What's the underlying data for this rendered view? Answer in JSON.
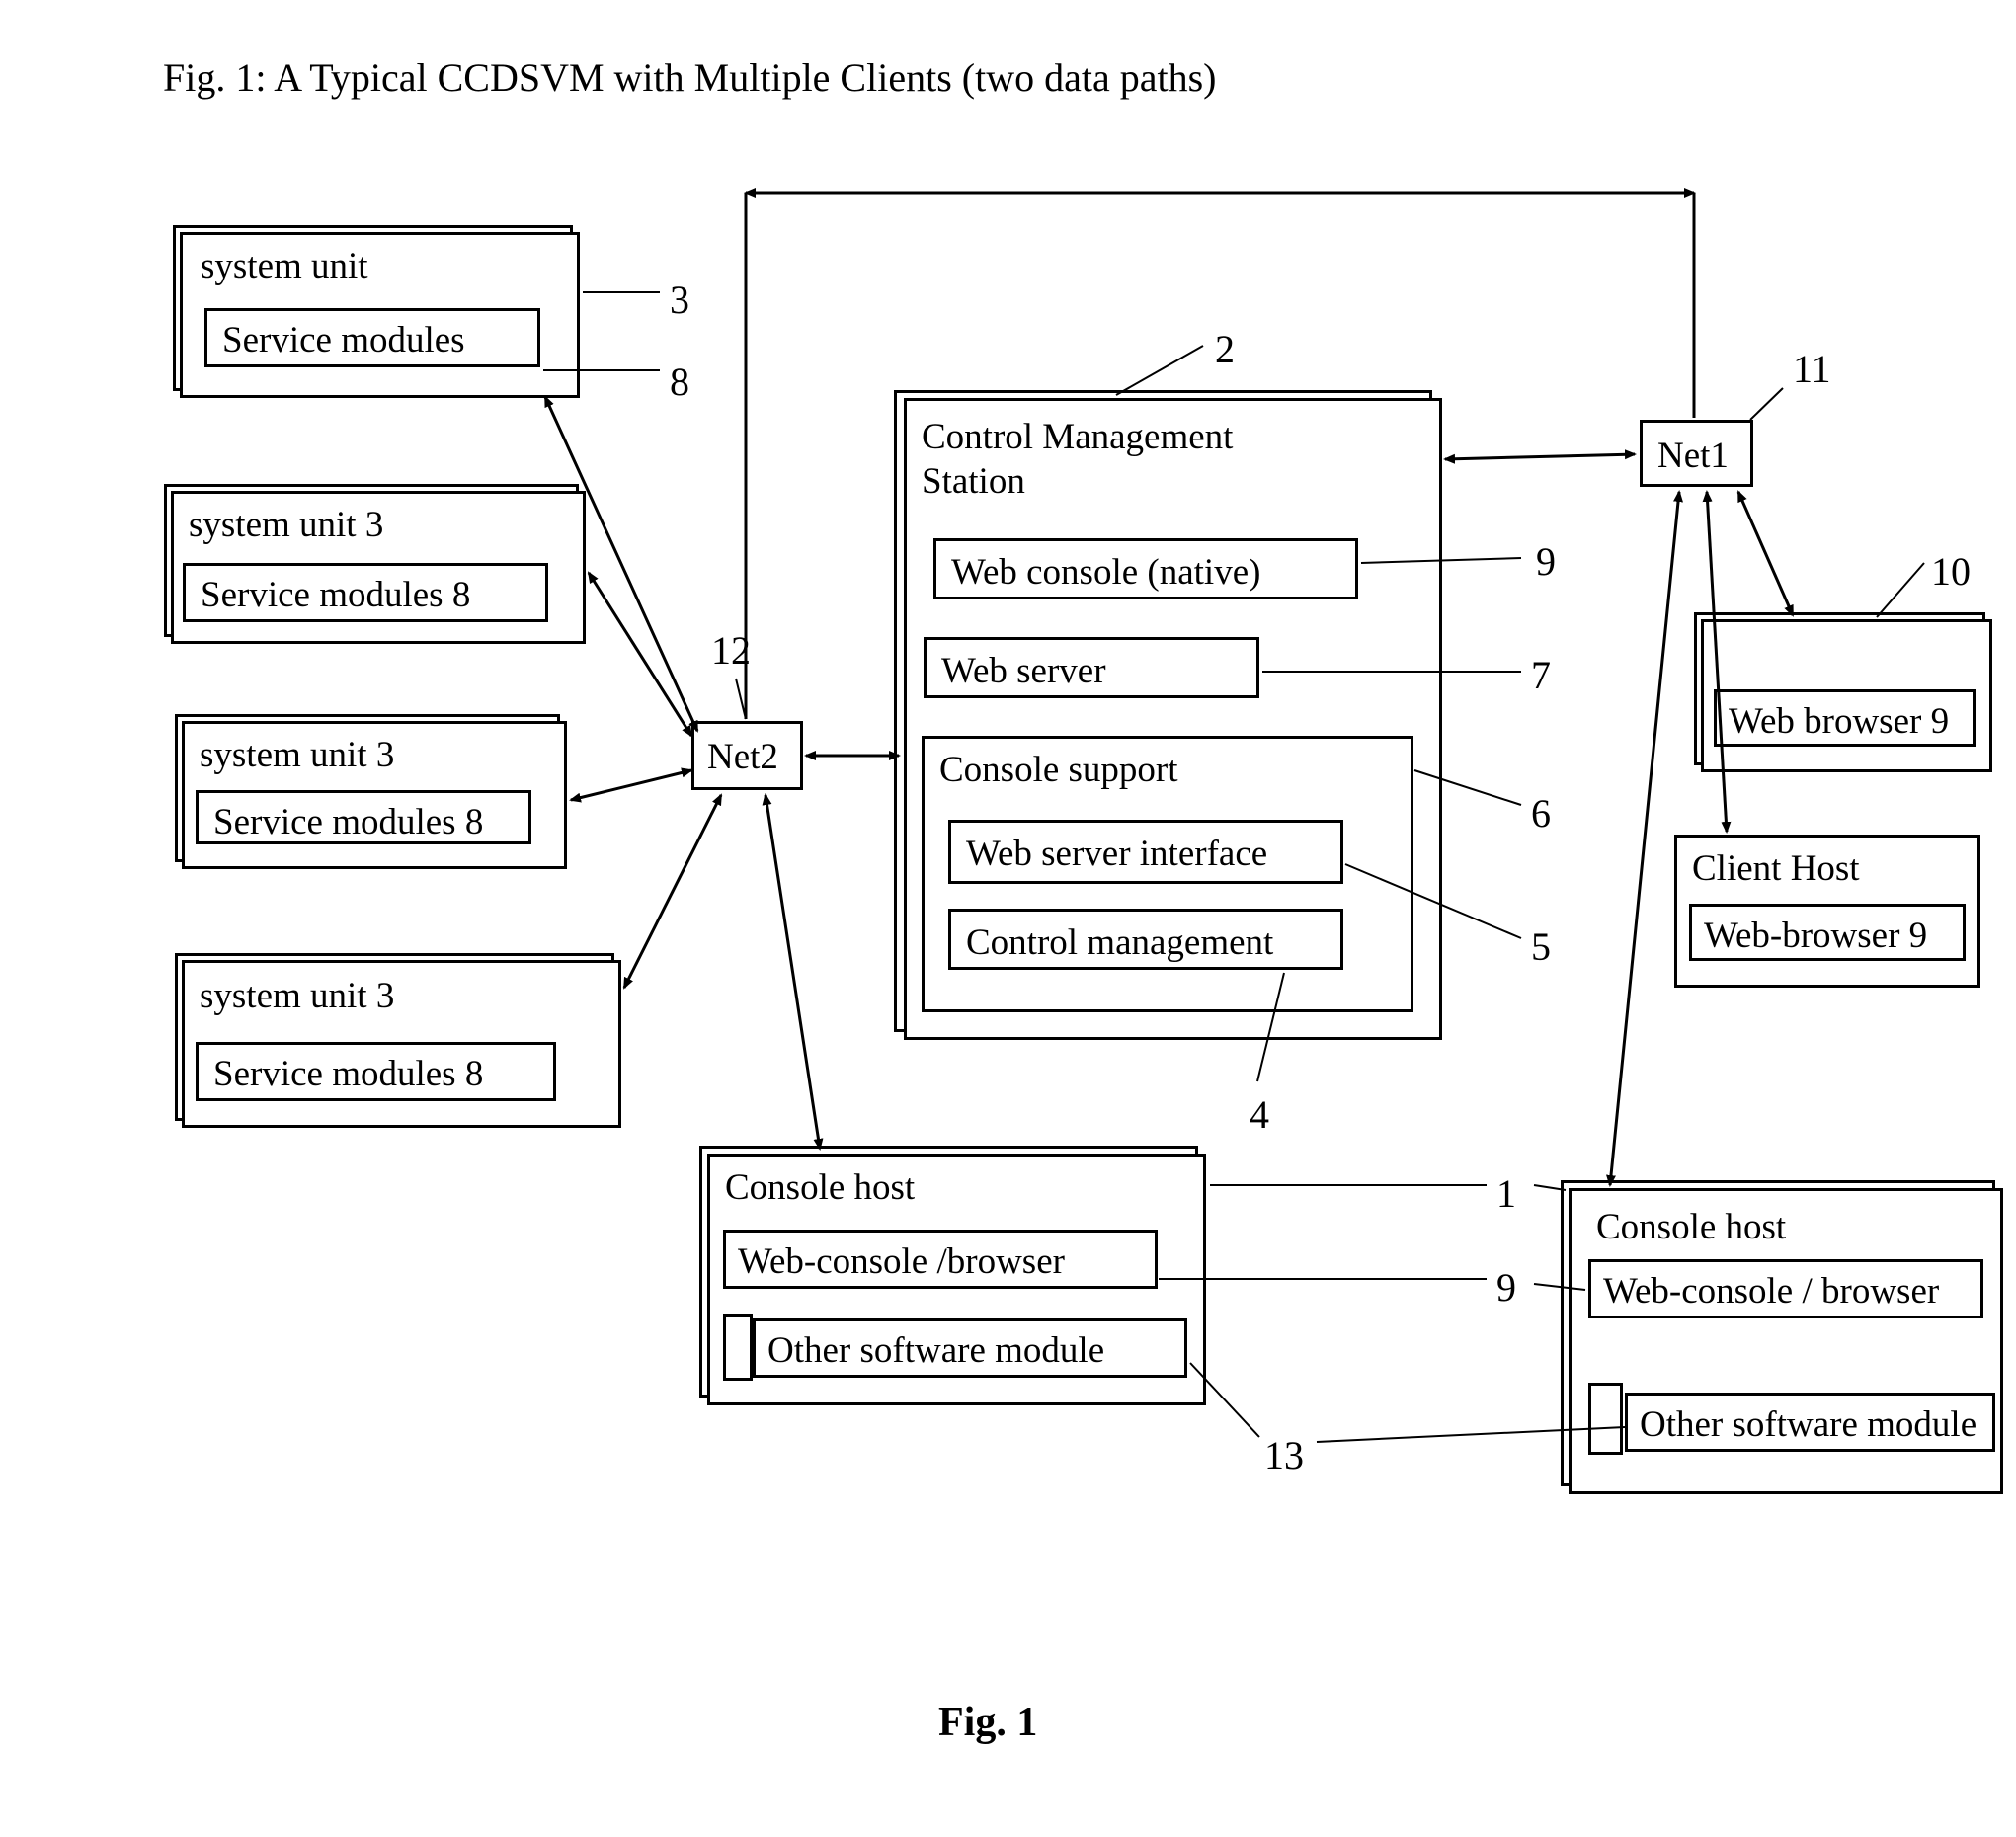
{
  "title": "Fig. 1: A Typical CCDSVM with Multiple Clients  (two data paths)",
  "figLabel": "Fig.  1",
  "numbers": {
    "n1": "1",
    "n2": "2",
    "n3": "3",
    "n4": "4",
    "n5": "5",
    "n6": "6",
    "n7": "7",
    "n8": "8",
    "n9a": "9",
    "n9b": "9",
    "n10": "10",
    "n11": "11",
    "n12": "12",
    "n13": "13"
  },
  "boxes": {
    "systemUnit1": {
      "title": "system unit",
      "module": "Service modules"
    },
    "systemUnit2": {
      "title": "system unit 3",
      "module": "Service modules 8"
    },
    "systemUnit3": {
      "title": "system unit  3",
      "module": "Service modules 8"
    },
    "systemUnit4": {
      "title": "system unit  3",
      "module": "Service modules 8"
    },
    "cms": {
      "title1": "Control Management",
      "title2": "Station",
      "webConsole": "Web console (native)",
      "webServer": "Web server",
      "consoleSupport": "Console support",
      "webServerInterface": "Web server interface",
      "controlMgmt": "Control management"
    },
    "net1": "Net1",
    "net2": "Net2",
    "clientHost1": {
      "title": "",
      "module": "Web browser 9"
    },
    "clientHost2": {
      "title": "Client Host",
      "module": "Web-browser 9"
    },
    "consoleHost1": {
      "title": "Console host",
      "module1": "Web-console /browser",
      "module2": "Other software module"
    },
    "consoleHost2": {
      "title": "Console host",
      "module1": "Web-console / browser",
      "module2": "Other software module"
    }
  }
}
